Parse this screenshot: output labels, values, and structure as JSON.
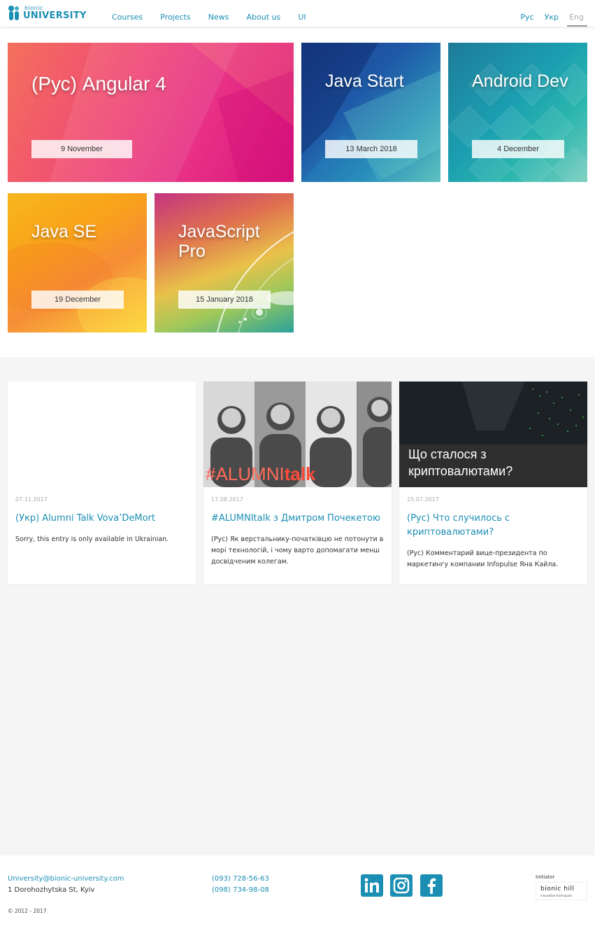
{
  "header": {
    "logo_small": "bionic",
    "logo_big": "UNIVERSITY",
    "nav": [
      "Courses",
      "Projects",
      "News",
      "About us",
      "UI"
    ],
    "langs": [
      "Рус",
      "Укр",
      "Eng"
    ],
    "active_lang": "Eng"
  },
  "courses": [
    {
      "title": "(Рус) Angular 4",
      "date": "9 November"
    },
    {
      "title": "Java Start",
      "date": "13 March 2018"
    },
    {
      "title": "Android Dev",
      "date": "4 December"
    },
    {
      "title": "Java SE",
      "date": "19 December"
    },
    {
      "title": "JavaScript Pro",
      "date": "15 January 2018"
    }
  ],
  "posts": [
    {
      "date": "07.11.2017",
      "title": "(Укр) Alumni Talk Vova’DeMort",
      "excerpt": "Sorry, this entry is only available in Ukrainian."
    },
    {
      "date": "17.08.2017",
      "title": "#ALUMNItalk з Дмитром Почекетою",
      "excerpt": "(Рус) Як верстальнику-початківцю не потонути в морі технологій, і чому варто допомагати менш досвідченим колегам.",
      "image_text_a": "#ALUMNI",
      "image_text_b": "talk"
    },
    {
      "date": "25.07.2017",
      "title": "(Рус) Что случилось с криптовалютами?",
      "excerpt": "(Рус) Комментарий вице-президента по маркетингу компании Infopulse Яна Кайла.",
      "image_text": "Що сталося з криптовалютами?"
    }
  ],
  "footer": {
    "email": "University@bionic-university.com",
    "address": "1 Dorohozhytska St, Kyiv",
    "copyright": "© 2012 - 2017",
    "phone1": "(093) 728-56-63",
    "phone2": "(098) 734-98-08",
    "initiator_label": "Initiator",
    "initiator_name": "bionic hill",
    "initiator_sub": "innovation technopark"
  },
  "colors": {
    "accent": "#1b8fb3",
    "gray_bg": "#f5f5f5"
  }
}
